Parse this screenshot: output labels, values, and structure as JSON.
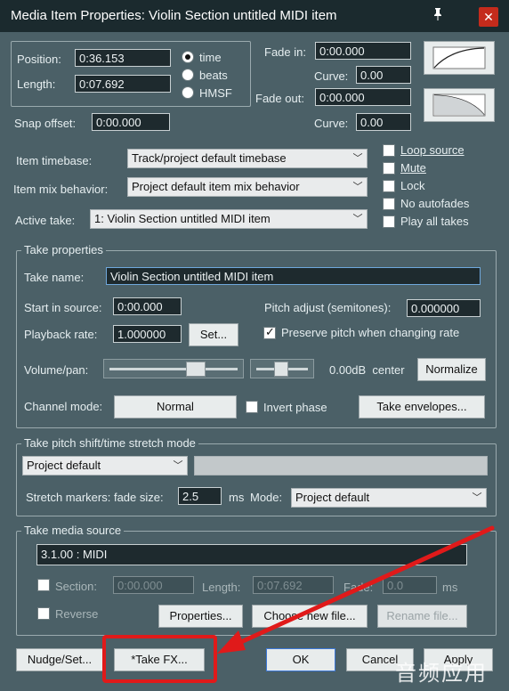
{
  "window": {
    "title": "Media Item Properties:  Violin Section untitled MIDI item",
    "pin_icon": "pin-icon",
    "close_icon": "close-icon",
    "close_glyph": "✕"
  },
  "position": {
    "label": "Position:",
    "value": "0:36.153"
  },
  "length": {
    "label": "Length:",
    "value": "0:07.692"
  },
  "timebase_radios": [
    {
      "label": "time",
      "selected": true
    },
    {
      "label": "beats",
      "selected": false
    },
    {
      "label": "HMSF",
      "selected": false
    }
  ],
  "snap_offset": {
    "label": "Snap offset:",
    "value": "0:00.000"
  },
  "fade_in": {
    "label": "Fade in:",
    "value": "0:00.000",
    "curve_label": "Curve:",
    "curve_value": "0.00"
  },
  "fade_out": {
    "label": "Fade out:",
    "value": "0:00.000",
    "curve_label": "Curve:",
    "curve_value": "0.00"
  },
  "item_timebase": {
    "label": "Item timebase:",
    "value": "Track/project default timebase"
  },
  "item_mix": {
    "label": "Item mix behavior:",
    "value": "Project default item mix behavior"
  },
  "active_take": {
    "label": "Active take:",
    "value": "1: Violin Section untitled MIDI item"
  },
  "item_flags": [
    {
      "label": "Loop source",
      "checked": false
    },
    {
      "label": "Mute",
      "checked": false
    },
    {
      "label": "Lock",
      "checked": false
    },
    {
      "label": "No autofades",
      "checked": false
    },
    {
      "label": "Play all takes",
      "checked": false
    }
  ],
  "take_properties": {
    "group_title": "Take properties",
    "name_label": "Take name:",
    "name_value": "Violin Section untitled MIDI item",
    "start_label": "Start in source:",
    "start_value": "0:00.000",
    "pitch_label": "Pitch adjust (semitones):",
    "pitch_value": "0.000000",
    "rate_label": "Playback rate:",
    "rate_value": "1.000000",
    "set_button": "Set...",
    "preserve_pitch": {
      "label": "Preserve pitch when changing rate",
      "checked": true
    },
    "volpan_label": "Volume/pan:",
    "vol_readout": "0.00dB  center",
    "normalize_button": "Normalize",
    "channel_label": "Channel mode:",
    "channel_button": "Normal",
    "invert_phase": {
      "label": "Invert phase",
      "checked": false
    },
    "envelopes_button": "Take envelopes..."
  },
  "pitch_shift": {
    "group_title": "Take pitch shift/time stretch mode",
    "mode_value": "Project default",
    "fade_label": "Stretch markers: fade size:",
    "fade_value": "2.5",
    "ms_label": "ms",
    "mode_label": "Mode:",
    "mode2_value": "Project default"
  },
  "media_source": {
    "group_title": "Take media source",
    "source_value": "3.1.00 : MIDI",
    "section": {
      "label": "Section:",
      "checked": false,
      "value": "0:00.000"
    },
    "length_label": "Length:",
    "length_value": "0:07.692",
    "fade_label": "Fade:",
    "fade_value": "0.0",
    "ms_label": "ms",
    "reverse": {
      "label": "Reverse",
      "checked": false
    },
    "properties_button": "Properties...",
    "choose_button": "Choose new file...",
    "rename_button": "Rename file..."
  },
  "bottom_buttons": {
    "nudge": "Nudge/Set...",
    "take_fx": "*Take FX...",
    "ok": "OK",
    "cancel": "Cancel",
    "apply": "Apply"
  },
  "watermark": "音频应用",
  "colors": {
    "annotation_red": "#e01a1a",
    "dialog_bg": "#4b6067"
  }
}
